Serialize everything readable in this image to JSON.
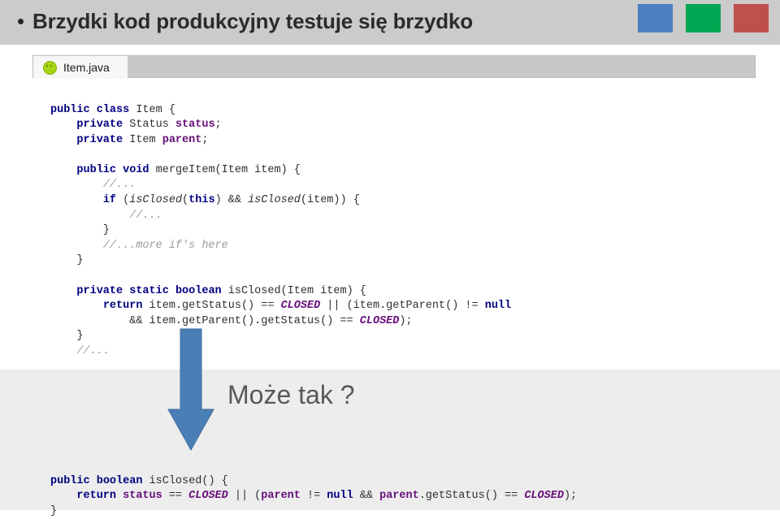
{
  "header": {
    "bullet_icon": "bullet-dot-icon",
    "title": "Brzydki kod produkcyjny testuje się brzydko",
    "background_color": "#cbcbcb",
    "swatches": [
      {
        "name": "blue-swatch",
        "color": "#4a7fc1"
      },
      {
        "name": "green-swatch",
        "color": "#00a651"
      },
      {
        "name": "red-swatch",
        "color": "#c0504d"
      }
    ]
  },
  "editor": {
    "tab": {
      "icon": "java-class-icon",
      "icon_color": "#a6d514",
      "label": "Item.java",
      "active": true
    },
    "tabbar_background": "#c8c8c8"
  },
  "code_top": {
    "lines": [
      [
        {
          "t": "public ",
          "c": "kw"
        },
        {
          "t": "class ",
          "c": "kw"
        },
        {
          "t": "Item {",
          "c": "plain"
        }
      ],
      [
        {
          "t": "    ",
          "c": "plain"
        },
        {
          "t": "private ",
          "c": "kw"
        },
        {
          "t": "Status ",
          "c": "plain"
        },
        {
          "t": "status",
          "c": "field"
        },
        {
          "t": ";",
          "c": "plain"
        }
      ],
      [
        {
          "t": "    ",
          "c": "plain"
        },
        {
          "t": "private ",
          "c": "kw"
        },
        {
          "t": "Item ",
          "c": "plain"
        },
        {
          "t": "parent",
          "c": "field"
        },
        {
          "t": ";",
          "c": "plain"
        }
      ],
      [
        {
          "t": "",
          "c": "plain"
        }
      ],
      [
        {
          "t": "    ",
          "c": "plain"
        },
        {
          "t": "public ",
          "c": "kw"
        },
        {
          "t": "void ",
          "c": "kw"
        },
        {
          "t": "mergeItem(Item item) {",
          "c": "plain"
        }
      ],
      [
        {
          "t": "        ",
          "c": "plain"
        },
        {
          "t": "//...",
          "c": "cmt"
        }
      ],
      [
        {
          "t": "        ",
          "c": "plain"
        },
        {
          "t": "if ",
          "c": "kw"
        },
        {
          "t": "(",
          "c": "plain"
        },
        {
          "t": "isClosed",
          "c": "meth"
        },
        {
          "t": "(",
          "c": "plain"
        },
        {
          "t": "this",
          "c": "kw"
        },
        {
          "t": ") && ",
          "c": "plain"
        },
        {
          "t": "isClosed",
          "c": "meth"
        },
        {
          "t": "(item)) {",
          "c": "plain"
        }
      ],
      [
        {
          "t": "            ",
          "c": "plain"
        },
        {
          "t": "//...",
          "c": "cmt"
        }
      ],
      [
        {
          "t": "        }",
          "c": "plain"
        }
      ],
      [
        {
          "t": "        ",
          "c": "plain"
        },
        {
          "t": "//...more if's here",
          "c": "cmt"
        }
      ],
      [
        {
          "t": "    }",
          "c": "plain"
        }
      ],
      [
        {
          "t": "",
          "c": "plain"
        }
      ],
      [
        {
          "t": "    ",
          "c": "plain"
        },
        {
          "t": "private ",
          "c": "kw"
        },
        {
          "t": "static ",
          "c": "kw"
        },
        {
          "t": "boolean ",
          "c": "kw"
        },
        {
          "t": "isClosed(Item item) {",
          "c": "plain"
        }
      ],
      [
        {
          "t": "        ",
          "c": "plain"
        },
        {
          "t": "return ",
          "c": "kw"
        },
        {
          "t": "item.getStatus() == ",
          "c": "plain"
        },
        {
          "t": "CLOSED",
          "c": "stat"
        },
        {
          "t": " || (item.getParent() != ",
          "c": "plain"
        },
        {
          "t": "null",
          "c": "kw"
        }
      ],
      [
        {
          "t": "            && item.getParent().getStatus() == ",
          "c": "plain"
        },
        {
          "t": "CLOSED",
          "c": "stat"
        },
        {
          "t": ");",
          "c": "plain"
        }
      ],
      [
        {
          "t": "    }",
          "c": "plain"
        }
      ],
      [
        {
          "t": "    ",
          "c": "plain"
        },
        {
          "t": "//...",
          "c": "cmt"
        }
      ]
    ]
  },
  "code_bottom": {
    "lines": [
      [
        {
          "t": "public ",
          "c": "kw"
        },
        {
          "t": "boolean ",
          "c": "kw"
        },
        {
          "t": "isClosed() {",
          "c": "plain"
        }
      ],
      [
        {
          "t": "    ",
          "c": "plain"
        },
        {
          "t": "return ",
          "c": "kw"
        },
        {
          "t": "status",
          "c": "field"
        },
        {
          "t": " == ",
          "c": "plain"
        },
        {
          "t": "CLOSED",
          "c": "stat"
        },
        {
          "t": " || (",
          "c": "plain"
        },
        {
          "t": "parent",
          "c": "field"
        },
        {
          "t": " != ",
          "c": "plain"
        },
        {
          "t": "null",
          "c": "kw"
        },
        {
          "t": " && ",
          "c": "plain"
        },
        {
          "t": "parent",
          "c": "field"
        },
        {
          "t": ".getStatus() == ",
          "c": "plain"
        },
        {
          "t": "CLOSED",
          "c": "stat"
        },
        {
          "t": ");",
          "c": "plain"
        }
      ],
      [
        {
          "t": "}",
          "c": "plain"
        }
      ]
    ]
  },
  "annotation": {
    "arrow_icon": "down-arrow-icon",
    "arrow_color": "#4a7fb5",
    "text": "Może tak ?",
    "text_color": "#595959"
  },
  "lower_band_color": "#ededed"
}
